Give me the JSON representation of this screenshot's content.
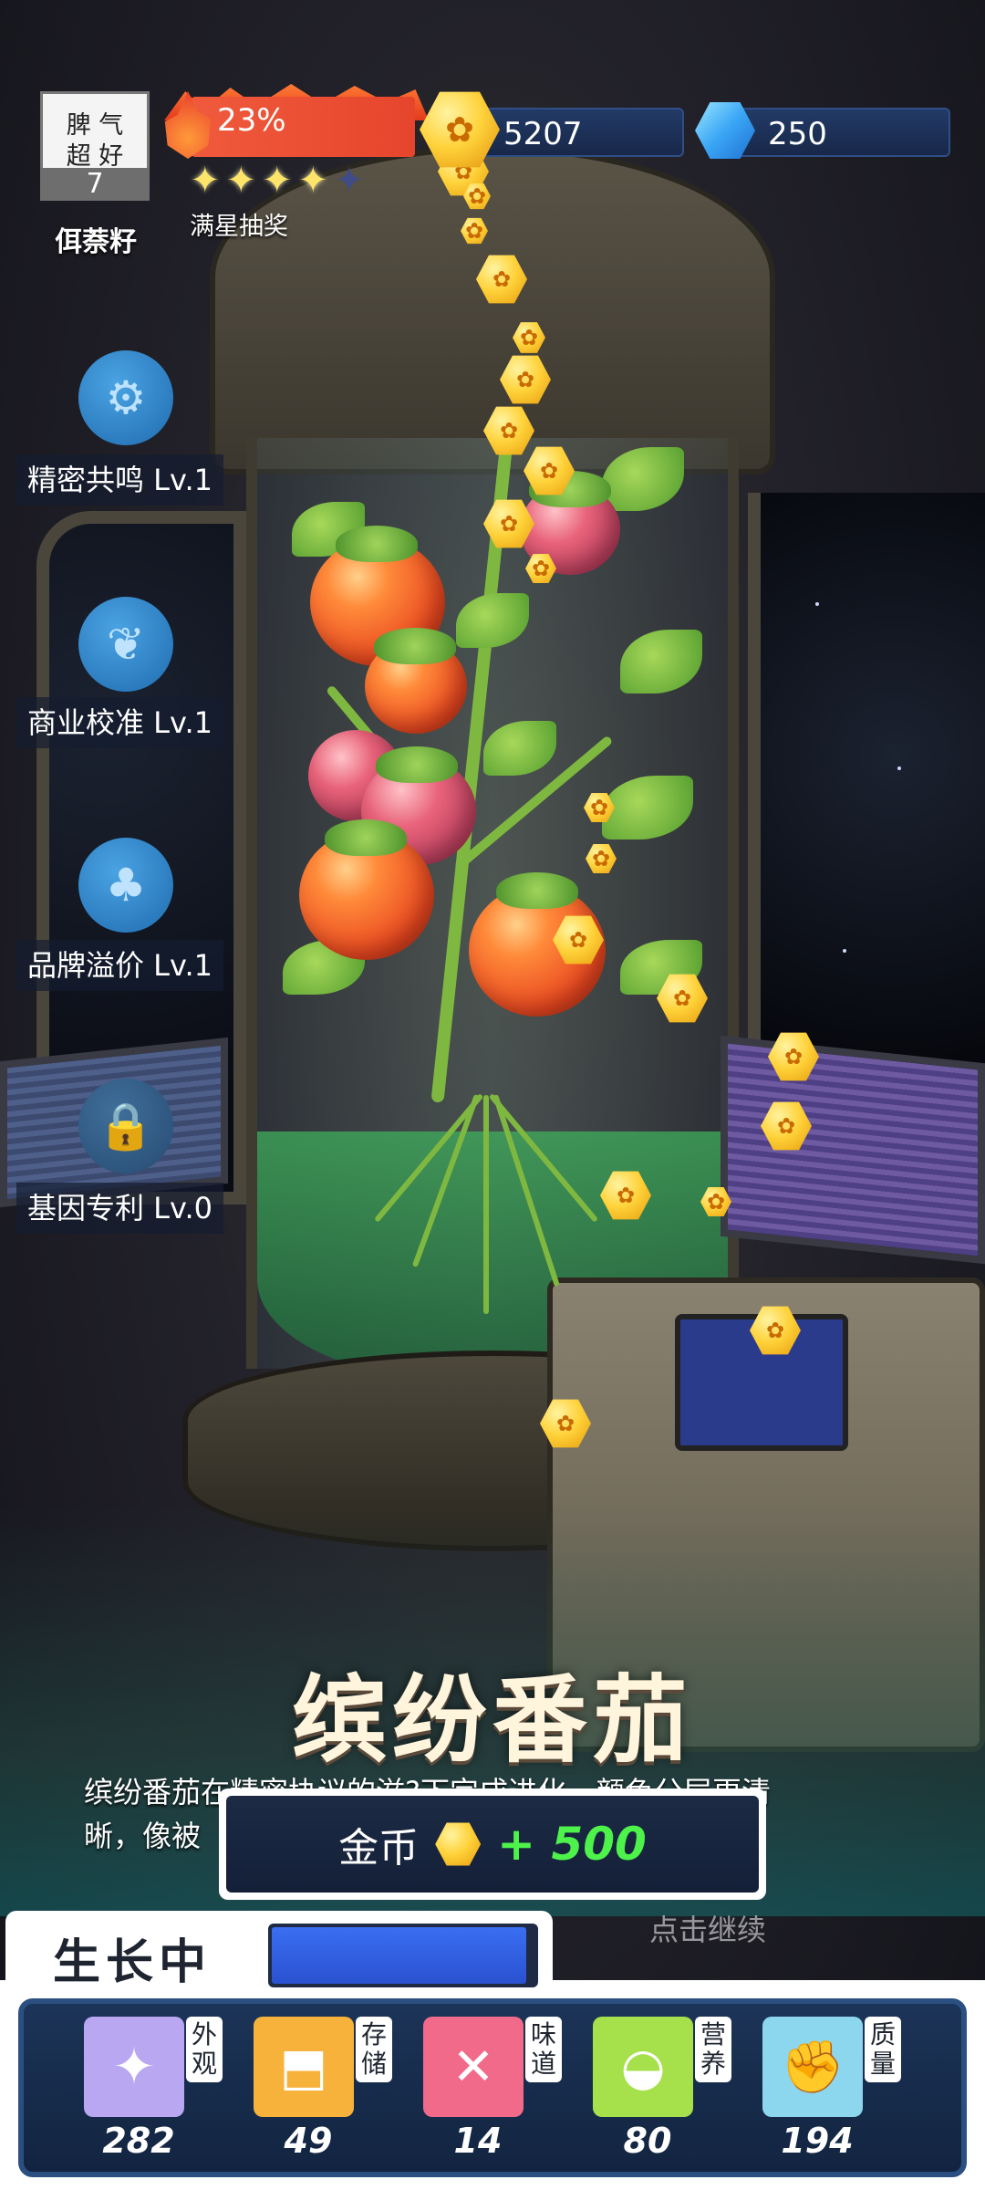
{
  "mood": {
    "line1": "脾 气",
    "line2": "超 好",
    "level": "7"
  },
  "plant_name_top": "佴萘籽",
  "fire": {
    "percent": "23%",
    "progress": 0.23
  },
  "stars": {
    "filled": 4,
    "total": 5,
    "label": "满星抽奖"
  },
  "resources": {
    "gold": "5207",
    "gems": "250"
  },
  "skills": [
    {
      "label": "精密共鸣 Lv.1",
      "icon": "gear-plant-icon"
    },
    {
      "label": "商业校准 Lv.1",
      "icon": "leaf-icon"
    },
    {
      "label": "品牌溢价 Lv.1",
      "icon": "crops-icon"
    },
    {
      "label": "基因专利 Lv.0",
      "icon": "lock-icon"
    }
  ],
  "title": "缤纷番茄",
  "description": {
    "line1": "缤纷番茄在精密协议的滋?下完成进化，颜色分层更清",
    "line2": "晰，像被"
  },
  "reward": {
    "label": "金币",
    "amount": "+ 500"
  },
  "tap_hint": "点击继续",
  "growth": {
    "label": "生长中",
    "progress": 0.97
  },
  "stats": [
    {
      "tag": "外观",
      "value": "282",
      "icon": "sparkle-icon",
      "color": "#b9a7f2"
    },
    {
      "tag": "存储",
      "value": "49",
      "icon": "box-icon",
      "color": "#f7b23c"
    },
    {
      "tag": "味道",
      "value": "14",
      "icon": "utensils-icon",
      "color": "#f26a8a"
    },
    {
      "tag": "营养",
      "value": "80",
      "icon": "lemon-icon",
      "color": "#a6e04a"
    },
    {
      "tag": "质量",
      "value": "194",
      "icon": "muscle-icon",
      "color": "#8cd6ee"
    }
  ]
}
